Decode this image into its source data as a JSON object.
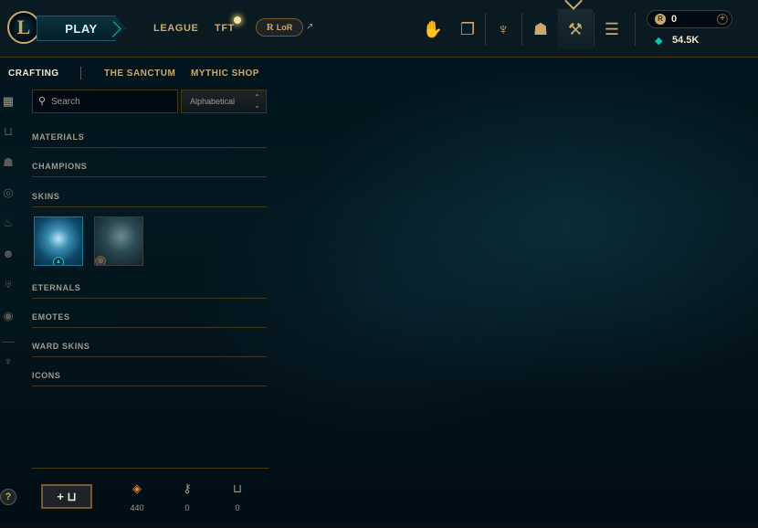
{
  "topbar": {
    "play_label": "PLAY",
    "logo_letter": "L",
    "nav": [
      "LEAGUE",
      "TFT"
    ],
    "lor_label": "LoR",
    "lor_icon": "R",
    "external_icon": "↗",
    "icons": [
      "social-icon",
      "collection-icon",
      "ranked-icon",
      "inventory-icon",
      "crafting-icon",
      "store-icon"
    ],
    "icon_glyphs": [
      "✋",
      "❐",
      "♆",
      "☗",
      "⚒",
      "☰"
    ],
    "rp": {
      "icon": "R",
      "value": "0",
      "plus": "+"
    },
    "blue_essence": {
      "icon": "◆",
      "value": "54.5K"
    },
    "colors": {
      "gold": "#c8aa6e",
      "teal": "#0ac8b9",
      "bg": "#010a13"
    }
  },
  "subtabs": [
    "CRAFTING",
    "THE SANCTUM",
    "MYTHIC SHOP"
  ],
  "rail_icons": {
    "names": [
      "all-items-icon",
      "chest-icon",
      "champion-icon",
      "mask-icon",
      "ward-icon",
      "emote-icon",
      "banner-icon",
      "profile-icon",
      "loot-icon"
    ],
    "glyphs": [
      "▦",
      "⊔",
      "☗",
      "◎",
      "♨",
      "☻",
      "♅",
      "◉",
      "♆"
    ]
  },
  "search": {
    "placeholder": "Search",
    "icon": "⚲"
  },
  "sort": {
    "value": "Alphabetical",
    "chevron": "⌃\n⌄"
  },
  "categories": [
    "MATERIALS",
    "CHAMPIONS",
    "SKINS",
    "ETERNALS",
    "EMOTES",
    "WARD SKINS",
    "ICONS"
  ],
  "skins": [
    {
      "badge": "▲"
    },
    {
      "badge": "◎"
    }
  ],
  "bottom": {
    "help_label": "?",
    "add_label": "+ ⊔",
    "resources": [
      {
        "icon": "◈",
        "value": "440",
        "color": "#e8833a"
      },
      {
        "icon": "⚷",
        "value": "0",
        "color": "#a09b8c"
      },
      {
        "icon": "⊔",
        "value": "0",
        "color": "#a09b8c"
      }
    ]
  }
}
